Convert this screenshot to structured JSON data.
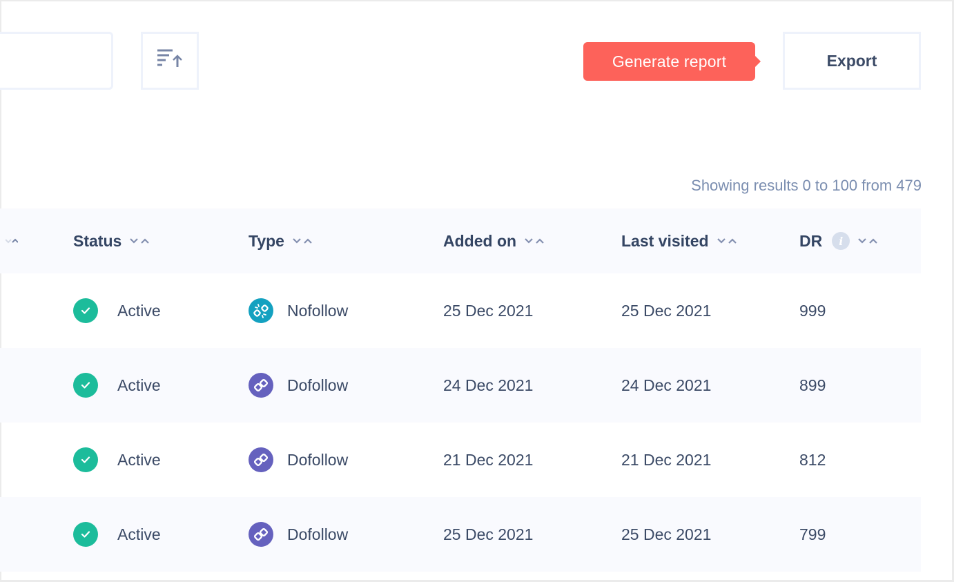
{
  "toolbar": {
    "search": {
      "value": "",
      "placeholder": ""
    },
    "sort_icon": "sort-ascending-icon",
    "generate_report_label": "Generate report",
    "export_label": "Export"
  },
  "results_info": "Showing results 0 to 100 from 479",
  "colors": {
    "accent": "#fd625a",
    "active": "#1cbc9b",
    "nofollow": "#14a1c0",
    "dofollow": "#6561be",
    "header_bg": "#f9fafe",
    "muted_text": "#7b8eb0"
  },
  "table": {
    "columns": [
      {
        "key": "status",
        "label": "Status"
      },
      {
        "key": "type",
        "label": "Type"
      },
      {
        "key": "added_on",
        "label": "Added on"
      },
      {
        "key": "last_visited",
        "label": "Last visited"
      },
      {
        "key": "dr",
        "label": "DR",
        "info_icon": true
      }
    ],
    "rows": [
      {
        "status": "Active",
        "type": "Nofollow",
        "type_icon": "broken-link-icon",
        "added_on": "25 Dec 2021",
        "last_visited": "25 Dec 2021",
        "dr": "999"
      },
      {
        "status": "Active",
        "type": "Dofollow",
        "type_icon": "link-icon",
        "added_on": "24 Dec 2021",
        "last_visited": "24 Dec 2021",
        "dr": "899"
      },
      {
        "status": "Active",
        "type": "Dofollow",
        "type_icon": "link-icon",
        "added_on": "21 Dec 2021",
        "last_visited": "21 Dec 2021",
        "dr": "812"
      },
      {
        "status": "Active",
        "type": "Dofollow",
        "type_icon": "link-icon",
        "added_on": "25 Dec 2021",
        "last_visited": "25 Dec 2021",
        "dr": "799"
      }
    ]
  }
}
